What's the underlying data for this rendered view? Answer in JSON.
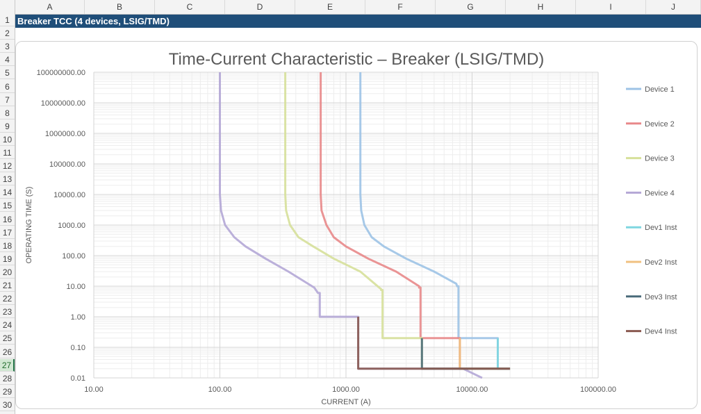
{
  "spreadsheet": {
    "columns": [
      "A",
      "B",
      "C",
      "D",
      "E",
      "F",
      "G",
      "H",
      "I",
      "J"
    ],
    "rows": [
      "1",
      "2",
      "3",
      "4",
      "5",
      "6",
      "7",
      "8",
      "9",
      "10",
      "11",
      "12",
      "13",
      "14",
      "15",
      "16",
      "17",
      "18",
      "19",
      "20",
      "21",
      "22",
      "23",
      "24",
      "25",
      "26",
      "27",
      "28",
      "29",
      "30"
    ],
    "active_row": "27",
    "banner": "Breaker TCC (4 devices, LSIG/TMD)"
  },
  "chart_data": {
    "type": "line",
    "title": "Time-Current Characteristic – Breaker (LSIG/TMD)",
    "xlabel": "CURRENT (A)",
    "ylabel": "OPERATING TIME (S)",
    "xscale": "log",
    "yscale": "log",
    "xlim": [
      10,
      100000
    ],
    "ylim": [
      0.01,
      100000000
    ],
    "xticks": [
      "10.00",
      "100.00",
      "1000.00",
      "10000.00",
      "100000.00"
    ],
    "yticks": [
      "100000000.00",
      "10000000.00",
      "1000000.00",
      "100000.00",
      "10000.00",
      "1000.00",
      "100.00",
      "10.00",
      "1.00",
      "0.10",
      "0.01"
    ],
    "grid": true,
    "legend_position": "right",
    "series": [
      {
        "name": "Device 1",
        "color": "#9dc3e6",
        "x": [
          1300,
          1300,
          1320,
          1400,
          1600,
          2000,
          3000,
          5000,
          7500,
          7600,
          7800,
          7800,
          16000,
          16000,
          16500
        ],
        "y": [
          100000000,
          10000,
          3000,
          1000,
          400,
          200,
          80,
          30,
          12,
          10,
          10,
          0.2,
          0.2,
          0.02,
          0.02
        ]
      },
      {
        "name": "Device 2",
        "color": "#e8888a",
        "x": [
          630,
          630,
          640,
          700,
          800,
          1000,
          1500,
          2500,
          3800,
          3800,
          3900,
          3900,
          8000,
          8000,
          8300
        ],
        "y": [
          100000000,
          10000,
          3000,
          1000,
          400,
          200,
          80,
          30,
          10,
          9,
          9,
          0.2,
          0.2,
          0.02,
          0.02
        ]
      },
      {
        "name": "Device 3",
        "color": "#d6e09a",
        "x": [
          330,
          330,
          335,
          360,
          420,
          550,
          800,
          1300,
          1900,
          1900,
          1950,
          1950,
          4000,
          4000,
          20000
        ],
        "y": [
          100000000,
          10000,
          3000,
          1000,
          400,
          200,
          80,
          30,
          8,
          7.5,
          7.5,
          0.2,
          0.2,
          0.02,
          0.02
        ]
      },
      {
        "name": "Device 4",
        "color": "#b4a7d6",
        "x": [
          100,
          100,
          102,
          110,
          130,
          160,
          230,
          350,
          560,
          600,
          620,
          620,
          1250,
          1250,
          1280,
          8500,
          12000
        ],
        "y": [
          100000000,
          10000,
          3000,
          1000,
          400,
          200,
          80,
          30,
          9,
          6,
          6,
          1,
          1,
          0.02,
          0.02,
          0.02,
          0.01
        ]
      },
      {
        "name": "Dev1 Inst",
        "color": "#7fd6e0",
        "x": [
          16000,
          16000,
          20000
        ],
        "y": [
          0.2,
          0.02,
          0.02
        ]
      },
      {
        "name": "Dev2 Inst",
        "color": "#f0c080",
        "x": [
          8000,
          8000,
          20000
        ],
        "y": [
          0.2,
          0.02,
          0.02
        ]
      },
      {
        "name": "Dev3 Inst",
        "color": "#4a6b7a",
        "x": [
          4000,
          4000,
          20000
        ],
        "y": [
          0.2,
          0.02,
          0.02
        ]
      },
      {
        "name": "Dev4 Inst",
        "color": "#8a5a50",
        "x": [
          1250,
          1250,
          20000
        ],
        "y": [
          1,
          0.02,
          0.02
        ]
      }
    ]
  }
}
